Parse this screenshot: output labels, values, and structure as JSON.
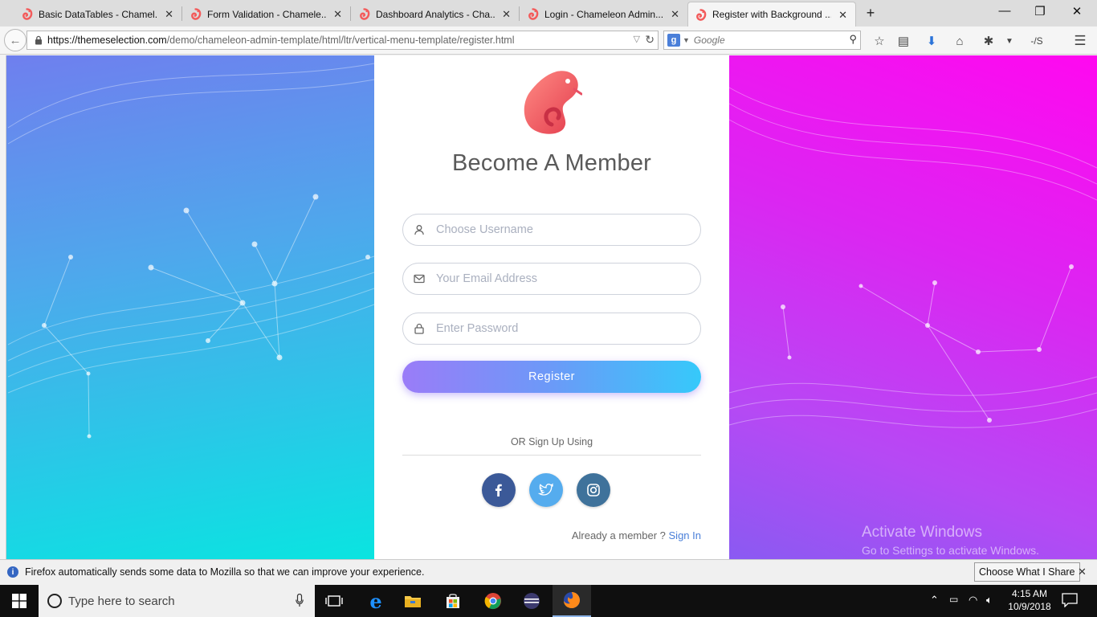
{
  "browser": {
    "tabs": [
      {
        "label": "Basic DataTables - Chamel...",
        "active": false
      },
      {
        "label": "Form Validation - Chamele...",
        "active": false
      },
      {
        "label": "Dashboard Analytics - Cha...",
        "active": false
      },
      {
        "label": "Login - Chameleon Admin...",
        "active": false
      },
      {
        "label": "Register with Background ...",
        "active": true
      }
    ],
    "url": {
      "host": "https://themeselection.com",
      "path": "/demo/chameleon-admin-template/html/ltr/vertical-menu-template/register.html"
    },
    "search_placeholder": "Google"
  },
  "page": {
    "title": "Become A Member",
    "fields": {
      "username_placeholder": "Choose Username",
      "email_placeholder": "Your Email Address",
      "password_placeholder": "Enter Password"
    },
    "register_label": "Register",
    "or_text": "OR Sign Up Using",
    "social": [
      "facebook",
      "twitter",
      "instagram"
    ],
    "already_text": "Already a member ?",
    "signin_label": "Sign In",
    "colors": {
      "facebook": "#3b5998",
      "twitter": "#55acee",
      "instagram": "#3f729b",
      "accent": "#4a7fd9"
    }
  },
  "watermark": {
    "line1": "Activate Windows",
    "line2": "Go to Settings to activate Windows."
  },
  "notification": {
    "text": "Firefox automatically sends some data to Mozilla so that we can improve your experience.",
    "button": "Choose What I Share"
  },
  "taskbar": {
    "search_placeholder": "Type here to search",
    "time": "4:15 AM",
    "date": "10/9/2018"
  }
}
